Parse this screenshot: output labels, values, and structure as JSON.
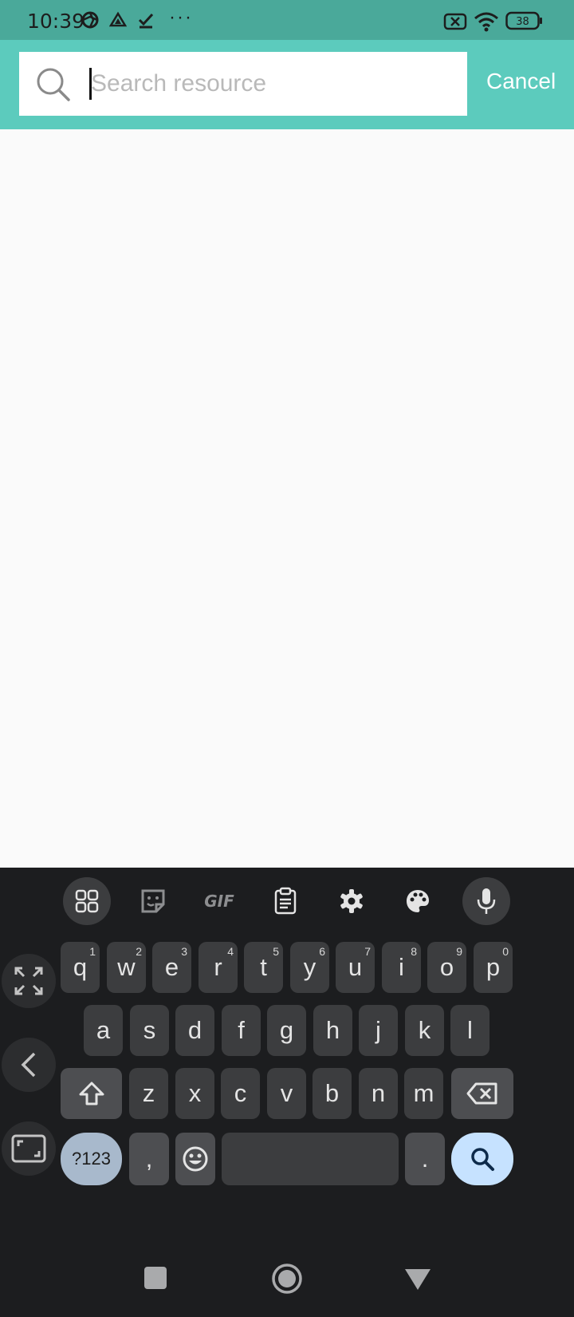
{
  "status_bar": {
    "time": "10:39",
    "battery": "38",
    "icons": [
      "aperture-icon",
      "drive-icon",
      "check-icon",
      "more-dots-icon",
      "no-sim-icon",
      "wifi-icon",
      "battery-icon"
    ]
  },
  "header": {
    "search_placeholder": "Search resource",
    "search_value": "",
    "cancel_label": "Cancel",
    "colors": {
      "header_bg": "#5ccbbd",
      "status_bg": "#4aa99a"
    }
  },
  "keyboard": {
    "toolbar": [
      "apps-icon",
      "sticker-icon",
      "GIF",
      "clipboard-icon",
      "settings-icon",
      "palette-icon",
      "mic-icon"
    ],
    "gif_label": "GIF",
    "row1": [
      {
        "k": "q",
        "h": "1"
      },
      {
        "k": "w",
        "h": "2"
      },
      {
        "k": "e",
        "h": "3"
      },
      {
        "k": "r",
        "h": "4"
      },
      {
        "k": "t",
        "h": "5"
      },
      {
        "k": "y",
        "h": "6"
      },
      {
        "k": "u",
        "h": "7"
      },
      {
        "k": "i",
        "h": "8"
      },
      {
        "k": "o",
        "h": "9"
      },
      {
        "k": "p",
        "h": "0"
      }
    ],
    "row2": [
      "a",
      "s",
      "d",
      "f",
      "g",
      "h",
      "j",
      "k",
      "l"
    ],
    "row3": [
      "z",
      "x",
      "c",
      "v",
      "b",
      "n",
      "m"
    ],
    "symbols_label": "?123",
    "comma_label": ",",
    "period_label": "."
  },
  "nav_bar": [
    "recents-square-icon",
    "home-circle-icon",
    "back-triangle-icon"
  ]
}
